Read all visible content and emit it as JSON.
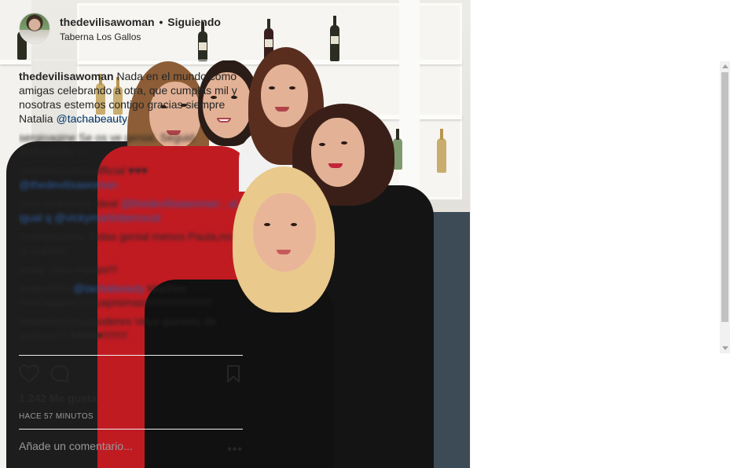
{
  "post": {
    "username": "thedevilisawoman",
    "separator": "•",
    "follow_status": "Siguiendo",
    "location": "Taberna Los Gallos"
  },
  "caption": {
    "username": "thedevilisawoman",
    "text": "Nada en el mundo como amigas celebrando a otra, que cumplas mil y nosotras estemos contigo gracias siempre Natalia",
    "mention": "@tachabeauty"
  },
  "comments": [
    {
      "user": "sergioagine",
      "text": "Se os ve genial. Seguid disfrutando ☺",
      "mention": ""
    },
    {
      "user": "marlovaquerizoofficial",
      "text": "♥♥♥",
      "mention": "@thedevilisawoman"
    },
    {
      "user": "mos.motherfull",
      "text": "Ideal",
      "mention": "@thedevilisawoman , al igual q @vickymartinberrocal"
    },
    {
      "user": "cvallejosalina",
      "text": "Todas genial menos Paula,no la soporto",
      "mention": ""
    },
    {
      "user": "amldj",
      "text": "Vaya equipo!!!",
      "mention": ""
    },
    {
      "user": "quique080",
      "text": "Muchas Felicidades!!!!Guapisimas!!!!!!!!!!!!!!!!!!!!!!",
      "mention": "@tachabeauty"
    },
    {
      "user": "laspiedrasysuspoderes",
      "text": "Vaya quinteto de guapas!!!! ♥♥♥♥♥!!!!!!!!",
      "mention": ""
    }
  ],
  "likes": "1.242 Me gusta",
  "timestamp": "HACE 57 MINUTOS",
  "comment_placeholder": "Añade un comentario...",
  "more_options": "•••",
  "icons": {
    "like": "heart-icon",
    "comment": "comment-icon",
    "save": "bookmark-icon",
    "options": "more-options-icon"
  },
  "colors": {
    "text": "#262626",
    "muted": "#999999",
    "mention": "#003569",
    "border": "#efefef"
  }
}
